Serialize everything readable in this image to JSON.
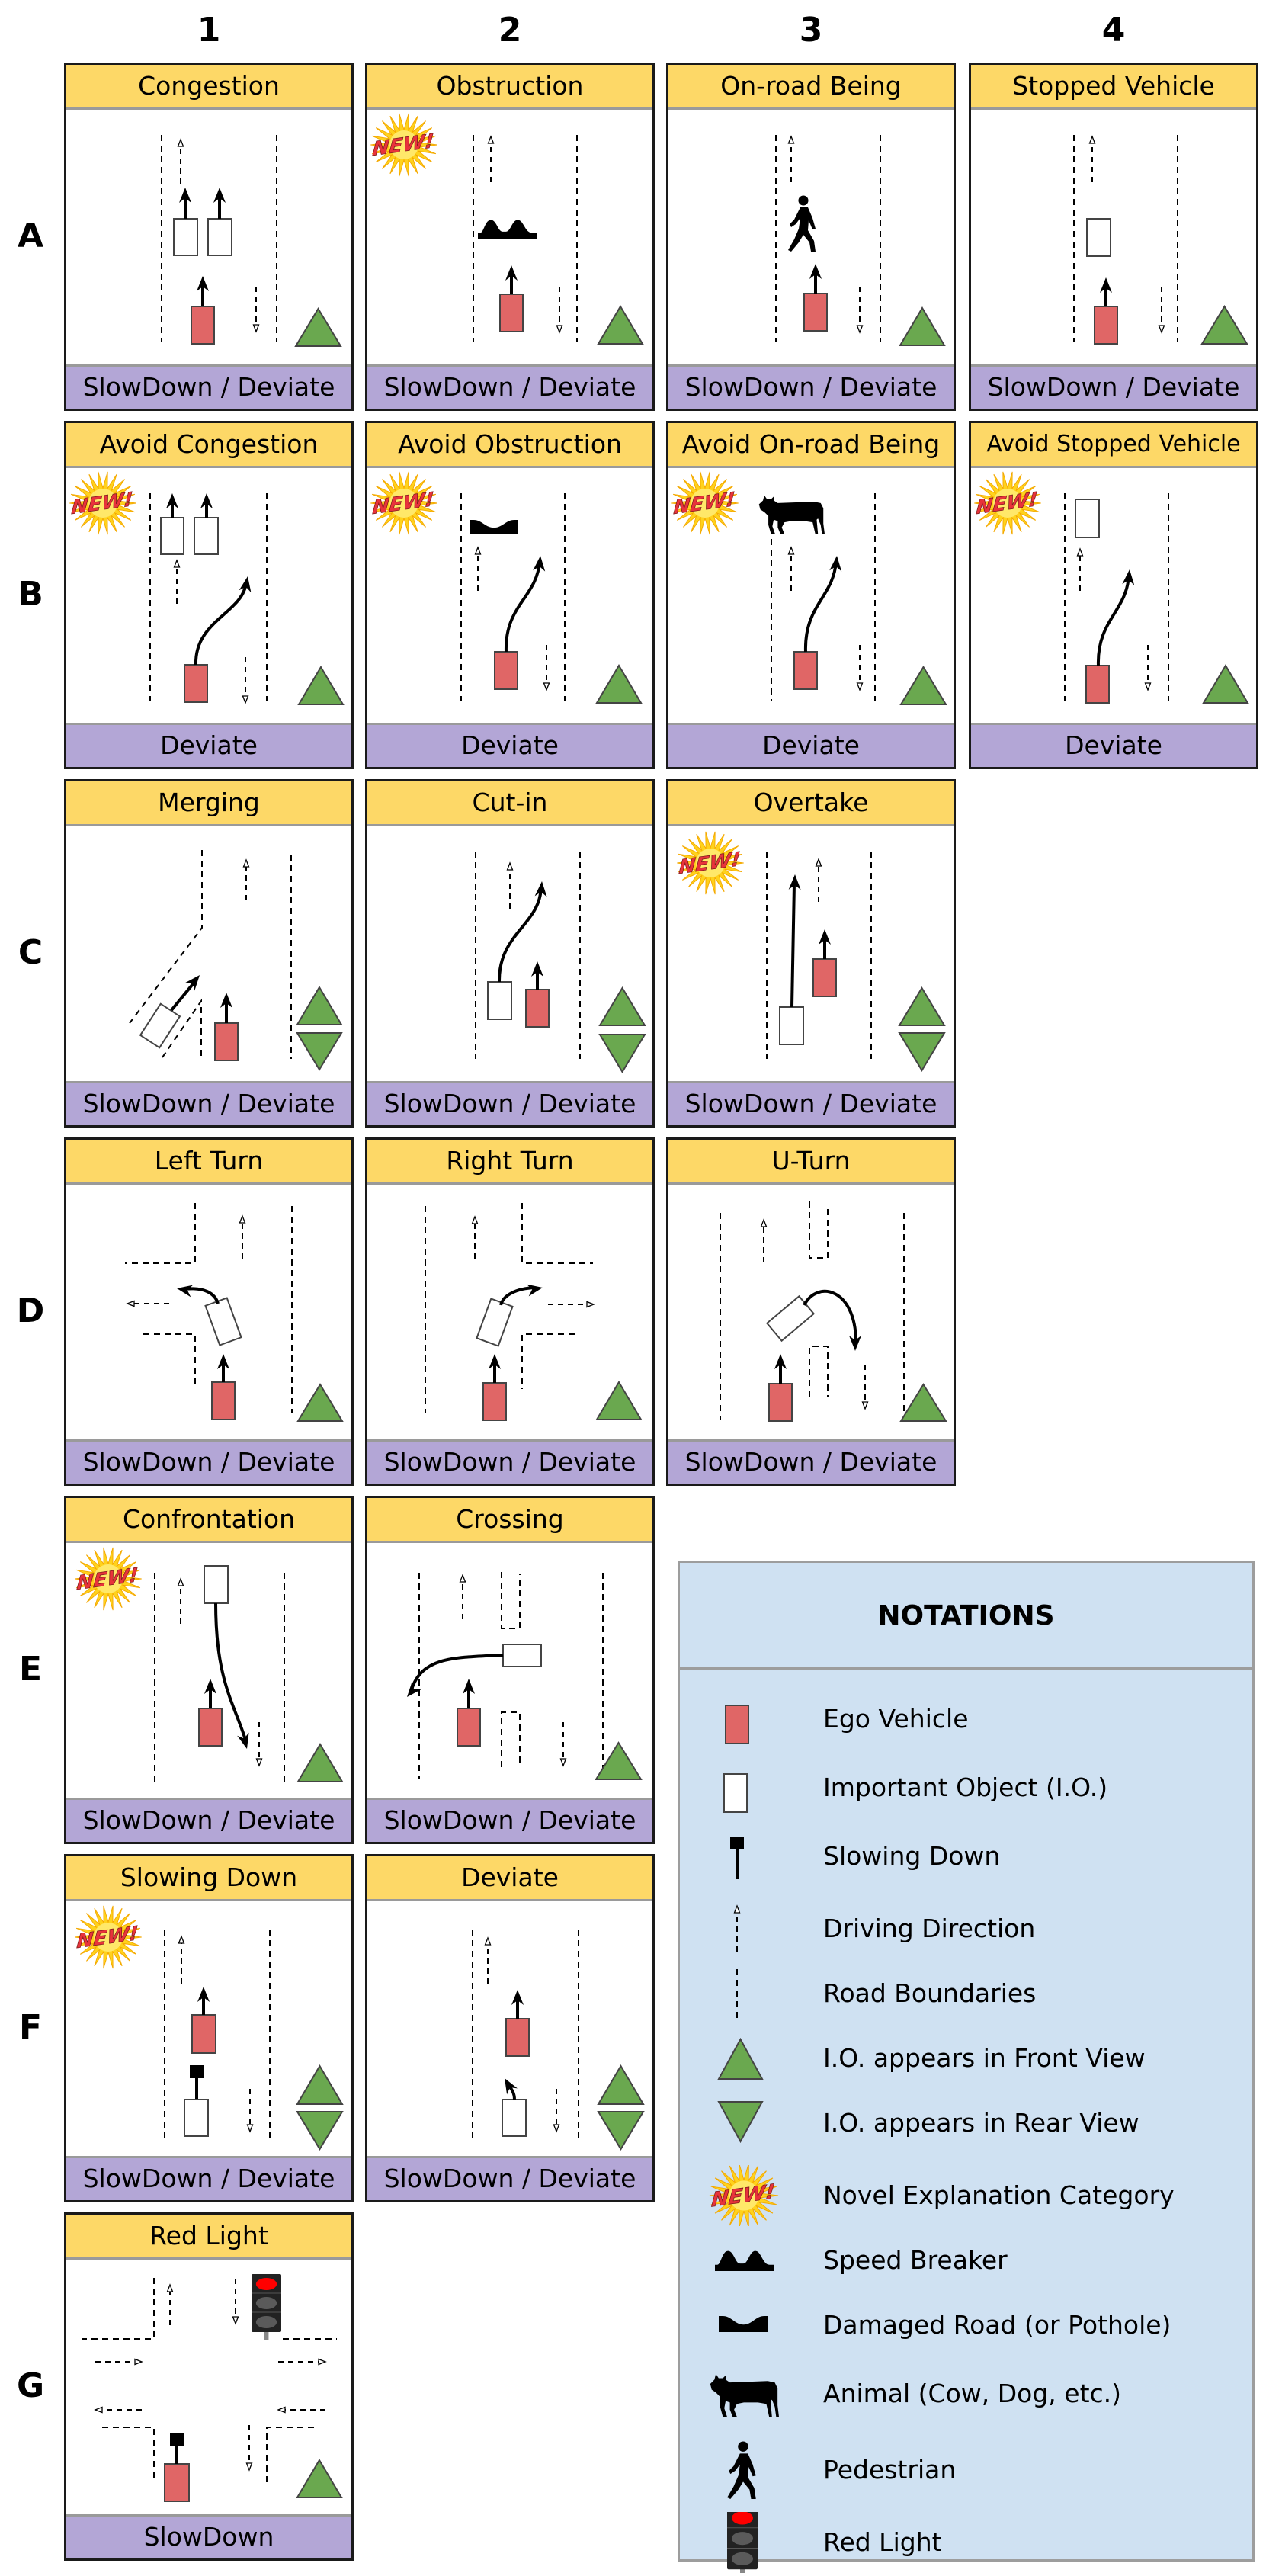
{
  "figure": {
    "column_labels": [
      "1",
      "2",
      "3",
      "4"
    ],
    "row_labels": [
      "A",
      "B",
      "C",
      "D",
      "E",
      "F",
      "G"
    ],
    "colors": {
      "header_bg": "#fdd867",
      "footer_bg": "#b3a6d6",
      "ego_vehicle": "#e06666",
      "important_object": "#ffffff",
      "view_triangle": "#6aa84f",
      "notations_bg": "#cfe1f2",
      "red_light": "#ff0000"
    },
    "cards": [
      {
        "id": "A1",
        "row": "A",
        "col": "1",
        "title": "Congestion",
        "action": "SlowDown / Deviate",
        "is_new": false,
        "views": [
          "front"
        ],
        "objects": [
          "ego-vehicle",
          "important-object",
          "important-object"
        ]
      },
      {
        "id": "A2",
        "row": "A",
        "col": "2",
        "title": "Obstruction",
        "action": "SlowDown / Deviate",
        "is_new": true,
        "views": [
          "front"
        ],
        "objects": [
          "ego-vehicle",
          "speed-breaker"
        ]
      },
      {
        "id": "A3",
        "row": "A",
        "col": "3",
        "title": "On-road Being",
        "action": "SlowDown / Deviate",
        "is_new": false,
        "views": [
          "front"
        ],
        "objects": [
          "ego-vehicle",
          "pedestrian"
        ]
      },
      {
        "id": "A4",
        "row": "A",
        "col": "4",
        "title": "Stopped Vehicle",
        "action": "SlowDown / Deviate",
        "is_new": false,
        "views": [
          "front"
        ],
        "objects": [
          "ego-vehicle",
          "important-object"
        ]
      },
      {
        "id": "B1",
        "row": "B",
        "col": "1",
        "title": "Avoid Congestion",
        "action": "Deviate",
        "is_new": true,
        "views": [
          "front"
        ],
        "objects": [
          "ego-vehicle",
          "important-object",
          "important-object"
        ]
      },
      {
        "id": "B2",
        "row": "B",
        "col": "2",
        "title": "Avoid Obstruction",
        "action": "Deviate",
        "is_new": true,
        "views": [
          "front"
        ],
        "objects": [
          "ego-vehicle",
          "damaged-road"
        ]
      },
      {
        "id": "B3",
        "row": "B",
        "col": "3",
        "title": "Avoid On-road Being",
        "action": "Deviate",
        "is_new": true,
        "views": [
          "front"
        ],
        "objects": [
          "ego-vehicle",
          "animal"
        ]
      },
      {
        "id": "B4",
        "row": "B",
        "col": "4",
        "title": "Avoid Stopped Vehicle",
        "action": "Deviate",
        "is_new": true,
        "views": [
          "front"
        ],
        "objects": [
          "ego-vehicle",
          "important-object"
        ]
      },
      {
        "id": "C1",
        "row": "C",
        "col": "1",
        "title": "Merging",
        "action": "SlowDown / Deviate",
        "is_new": false,
        "views": [
          "front",
          "rear"
        ],
        "objects": [
          "ego-vehicle",
          "important-object"
        ]
      },
      {
        "id": "C2",
        "row": "C",
        "col": "2",
        "title": "Cut-in",
        "action": "SlowDown / Deviate",
        "is_new": false,
        "views": [
          "front",
          "rear"
        ],
        "objects": [
          "ego-vehicle",
          "important-object"
        ]
      },
      {
        "id": "C3",
        "row": "C",
        "col": "3",
        "title": "Overtake",
        "action": "SlowDown / Deviate",
        "is_new": true,
        "views": [
          "front",
          "rear"
        ],
        "objects": [
          "ego-vehicle",
          "important-object"
        ]
      },
      {
        "id": "D1",
        "row": "D",
        "col": "1",
        "title": "Left Turn",
        "action": "SlowDown / Deviate",
        "is_new": false,
        "views": [
          "front"
        ],
        "objects": [
          "ego-vehicle",
          "important-object"
        ]
      },
      {
        "id": "D2",
        "row": "D",
        "col": "2",
        "title": "Right Turn",
        "action": "SlowDown / Deviate",
        "is_new": false,
        "views": [
          "front"
        ],
        "objects": [
          "ego-vehicle",
          "important-object"
        ]
      },
      {
        "id": "D3",
        "row": "D",
        "col": "3",
        "title": "U-Turn",
        "action": "SlowDown / Deviate",
        "is_new": false,
        "views": [
          "front"
        ],
        "objects": [
          "ego-vehicle",
          "important-object"
        ]
      },
      {
        "id": "E1",
        "row": "E",
        "col": "1",
        "title": "Confrontation",
        "action": "SlowDown / Deviate",
        "is_new": true,
        "views": [
          "front"
        ],
        "objects": [
          "ego-vehicle",
          "important-object"
        ]
      },
      {
        "id": "E2",
        "row": "E",
        "col": "2",
        "title": "Crossing",
        "action": "SlowDown / Deviate",
        "is_new": false,
        "views": [
          "front"
        ],
        "objects": [
          "ego-vehicle",
          "important-object"
        ]
      },
      {
        "id": "F1",
        "row": "F",
        "col": "1",
        "title": "Slowing Down",
        "action": "SlowDown / Deviate",
        "is_new": true,
        "views": [
          "front",
          "rear"
        ],
        "objects": [
          "ego-vehicle",
          "important-object",
          "slowing-down"
        ]
      },
      {
        "id": "F2",
        "row": "F",
        "col": "2",
        "title": "Deviate",
        "action": "SlowDown / Deviate",
        "is_new": false,
        "views": [
          "front",
          "rear"
        ],
        "objects": [
          "ego-vehicle",
          "important-object"
        ]
      },
      {
        "id": "G1",
        "row": "G",
        "col": "1",
        "title": "Red Light",
        "action": "SlowDown",
        "is_new": false,
        "views": [
          "front"
        ],
        "objects": [
          "ego-vehicle",
          "red-light",
          "slowing-down"
        ]
      }
    ],
    "new_badge_text": "NEW!",
    "notations": {
      "title": "NOTATIONS",
      "items": [
        {
          "icon": "ego-vehicle",
          "label": "Ego Vehicle"
        },
        {
          "icon": "important-object",
          "label": "Important Object (I.O.)"
        },
        {
          "icon": "slowing-down",
          "label": "Slowing Down"
        },
        {
          "icon": "driving-direction",
          "label": "Driving Direction"
        },
        {
          "icon": "road-boundary",
          "label": "Road Boundaries"
        },
        {
          "icon": "front-view-triangle",
          "label": "I.O. appears in Front View"
        },
        {
          "icon": "rear-view-triangle",
          "label": "I.O. appears in Rear View"
        },
        {
          "icon": "new-badge",
          "label": "Novel Explanation Category"
        },
        {
          "icon": "speed-breaker",
          "label": "Speed Breaker"
        },
        {
          "icon": "damaged-road",
          "label": "Damaged Road (or Pothole)"
        },
        {
          "icon": "animal",
          "label": "Animal (Cow, Dog, etc.)"
        },
        {
          "icon": "pedestrian",
          "label": "Pedestrian"
        },
        {
          "icon": "red-light",
          "label": "Red Light"
        }
      ]
    }
  }
}
